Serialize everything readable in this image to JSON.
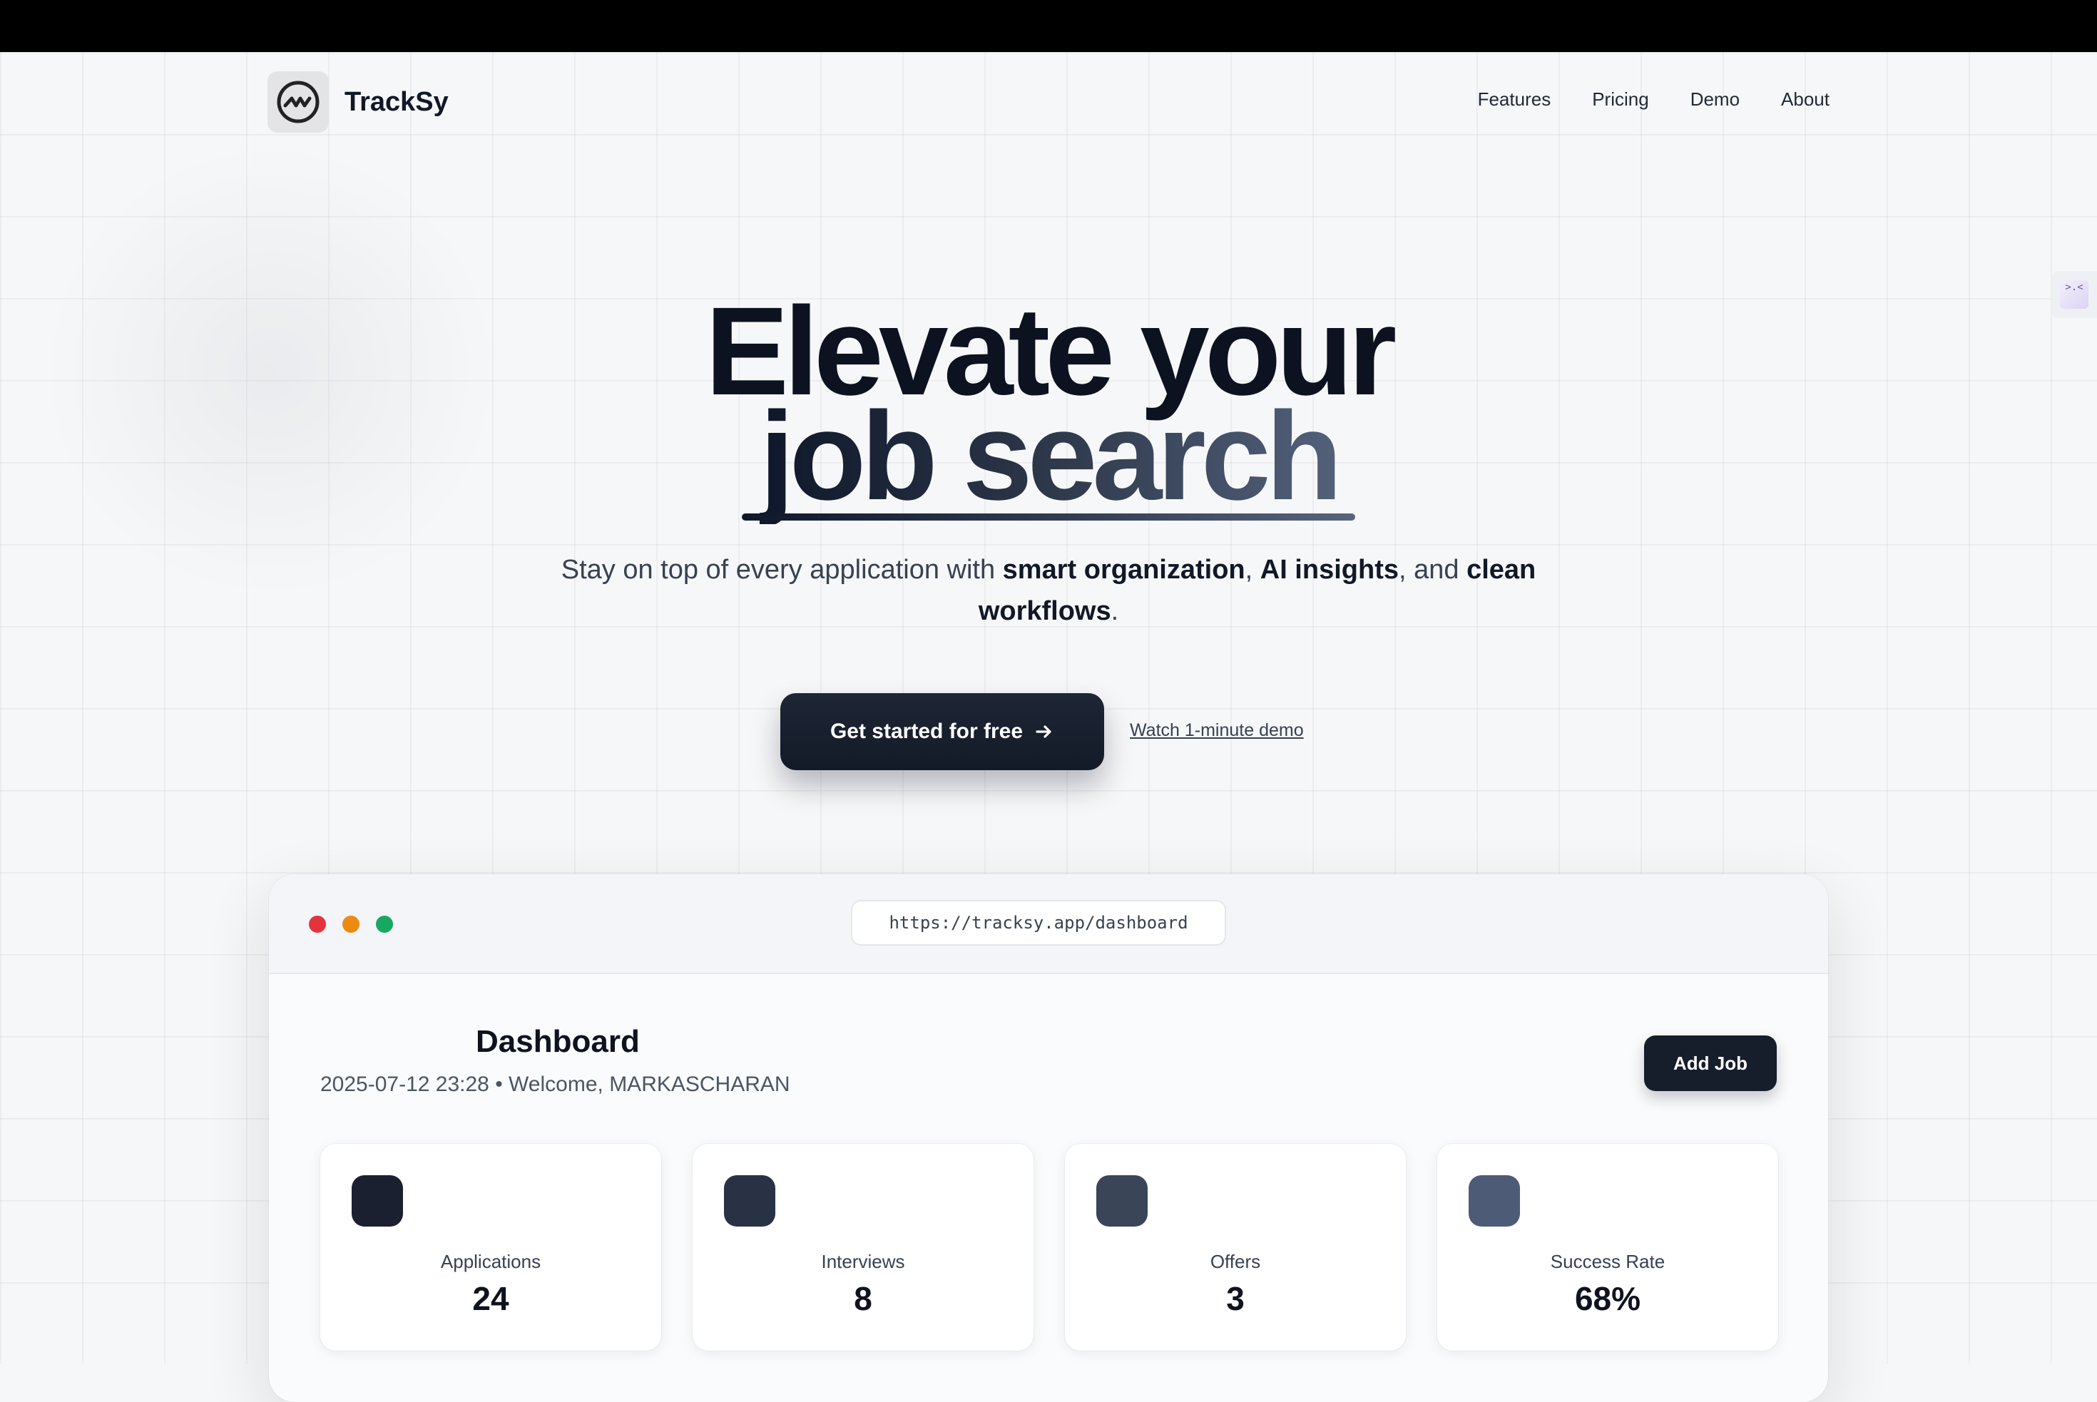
{
  "brand": {
    "name": "TrackSy",
    "logo_icon": "pulse-circle-icon"
  },
  "nav": {
    "items": [
      "Features",
      "Pricing",
      "Demo",
      "About"
    ]
  },
  "hero": {
    "line1": "Elevate your",
    "line2": "job search",
    "subtitle": {
      "p1": "Stay on top of every application with ",
      "b1": "smart organization",
      "p2": ", ",
      "b2": "AI insights",
      "p3": ", and ",
      "b3": "clean workflows",
      "p4": "."
    },
    "cta_label": "Get started for free",
    "cta_icon": "arrow-right-icon",
    "demo_link": "Watch 1-minute demo"
  },
  "side_widget": {
    "icon": "dev-toolbar-icon",
    "glyph": ">.<"
  },
  "browser": {
    "url": "https://tracksy.app/dashboard",
    "dashboard": {
      "title": "Dashboard",
      "subtitle": "2025-07-12 23:28 • Welcome, MARKASCHARAN",
      "add_job_label": "Add Job",
      "stats": [
        {
          "label": "Applications",
          "value": "24",
          "color": "#1a2030"
        },
        {
          "label": "Interviews",
          "value": "8",
          "color": "#283244"
        },
        {
          "label": "Offers",
          "value": "3",
          "color": "#3a4558"
        },
        {
          "label": "Success Rate",
          "value": "68%",
          "color": "#4d5b76"
        }
      ]
    }
  },
  "colors": {
    "accent_dark": "#131a27",
    "background": "#f6f7f8",
    "dot_red": "#e5333d",
    "dot_yellow": "#ec8a12",
    "dot_green": "#17a862"
  }
}
